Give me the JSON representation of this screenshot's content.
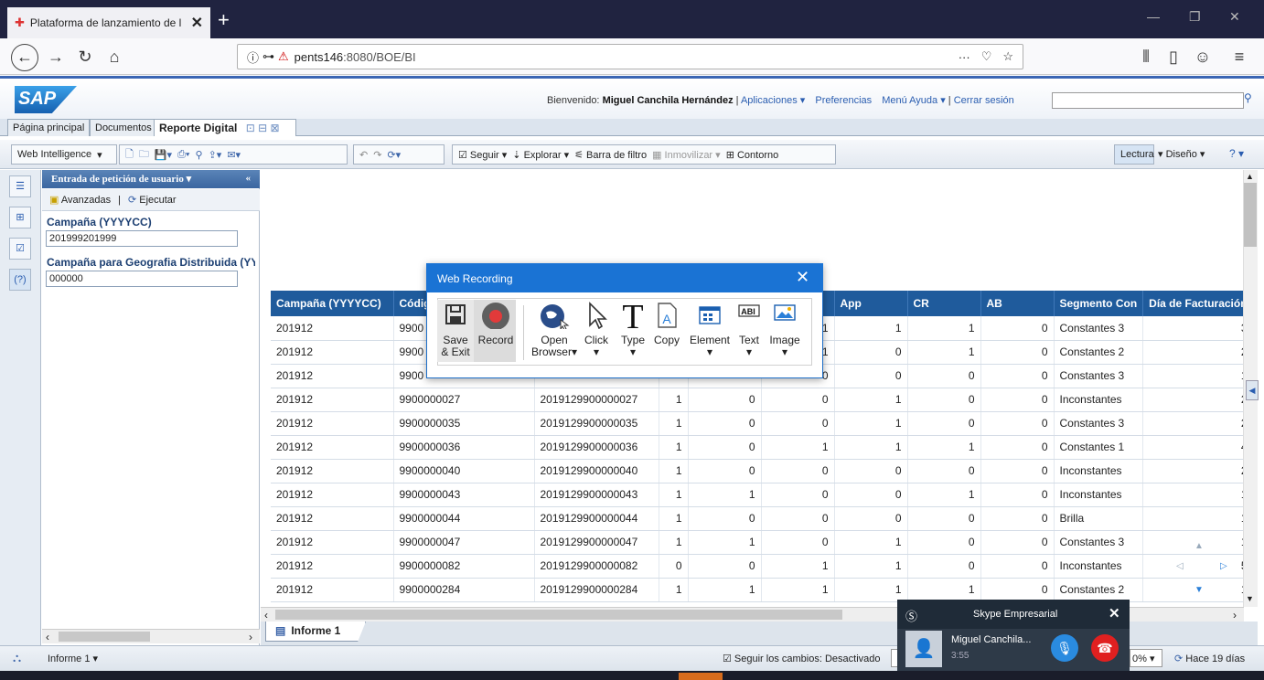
{
  "browser": {
    "tab_title": "Plataforma de lanzamiento de l",
    "url_host": "pents146",
    "url_path": ":8080/BOE/BI",
    "more": "···"
  },
  "sap": {
    "logo": "SAP",
    "welcome_prefix": "Bienvenido:",
    "user": "Miguel Canchila Hernández",
    "menu_apps": "Aplicaciones ▾",
    "menu_prefs": "Preferencias",
    "menu_help": "Menú Ayuda ▾",
    "logout": "Cerrar sesión",
    "tabs": [
      "Página principal",
      "Documentos",
      "Reporte Digital"
    ]
  },
  "toolbar": {
    "webi": "Web Intelligence",
    "seguir": "Seguir",
    "explorar": "Explorar",
    "barra_filtro": "Barra de filtro",
    "inmovilizar": "Inmovilizar",
    "contorno": "Contorno",
    "lectura": "Lectura",
    "diseno": "Diseño"
  },
  "prompt_panel": {
    "title": "Entrada de petición de usuario",
    "avanzadas": "Avanzadas",
    "ejecutar": "Ejecutar",
    "param1_label": "Campaña (YYYYCC)",
    "param1_value": "201999201999",
    "param2_label": "Campaña para Geografia Distribuida (YY",
    "param2_value": "000000"
  },
  "table": {
    "headers": [
      "Campaña (YYYYCC)",
      "Códig",
      "",
      "",
      "",
      "",
      "App",
      "CR",
      "AB",
      "Segmento Con",
      "Día de Facturación"
    ],
    "rows": [
      [
        "201912",
        "9900",
        "",
        "",
        "",
        "1",
        "1",
        "1",
        "0",
        "Constantes 3",
        "3"
      ],
      [
        "201912",
        "9900",
        "",
        "",
        "",
        "1",
        "0",
        "1",
        "0",
        "Constantes 2",
        "2"
      ],
      [
        "201912",
        "9900",
        "",
        "",
        "",
        "0",
        "0",
        "0",
        "0",
        "Constantes 3",
        "1"
      ],
      [
        "201912",
        "9900000027",
        "2019129900000027",
        "1",
        "0",
        "0",
        "1",
        "0",
        "0",
        "Inconstantes",
        "2"
      ],
      [
        "201912",
        "9900000035",
        "2019129900000035",
        "1",
        "0",
        "0",
        "1",
        "0",
        "0",
        "Constantes 3",
        "2"
      ],
      [
        "201912",
        "9900000036",
        "2019129900000036",
        "1",
        "0",
        "1",
        "1",
        "1",
        "0",
        "Constantes 1",
        "4"
      ],
      [
        "201912",
        "9900000040",
        "2019129900000040",
        "1",
        "0",
        "0",
        "0",
        "0",
        "0",
        "Inconstantes",
        "2"
      ],
      [
        "201912",
        "9900000043",
        "2019129900000043",
        "1",
        "1",
        "0",
        "0",
        "1",
        "0",
        "Inconstantes",
        "1"
      ],
      [
        "201912",
        "9900000044",
        "2019129900000044",
        "1",
        "0",
        "0",
        "0",
        "0",
        "0",
        "Brilla",
        "1"
      ],
      [
        "201912",
        "9900000047",
        "2019129900000047",
        "1",
        "1",
        "0",
        "1",
        "0",
        "0",
        "Constantes 3",
        "1"
      ],
      [
        "201912",
        "9900000082",
        "2019129900000082",
        "0",
        "0",
        "1",
        "1",
        "0",
        "0",
        "Inconstantes",
        "5"
      ],
      [
        "201912",
        "9900000284",
        "2019129900000284",
        "1",
        "1",
        "1",
        "1",
        "1",
        "0",
        "Constantes 2",
        "1"
      ]
    ]
  },
  "report_tab": "Informe 1",
  "status": {
    "informe": "Informe 1",
    "seguir_cambios": "Seguir los cambios: Desactivado",
    "zoom": "0%",
    "hace": "Hace 19 días"
  },
  "web_recording": {
    "title": "Web Recording",
    "buttons": {
      "save": "Save",
      "exit": "& Exit",
      "record": "Record",
      "open": "Open",
      "browser": "Browser",
      "click": "Click",
      "type": "Type",
      "copy": "Copy",
      "element": "Element",
      "text": "Text",
      "image": "Image"
    }
  },
  "skype": {
    "title": "Skype Empresarial",
    "caller": "Miguel Canchila...",
    "duration": "3:55"
  },
  "colors": {
    "sap_blue": "#1f5b9c",
    "wr_blue": "#1a73d4",
    "ff_dark": "#202340"
  }
}
